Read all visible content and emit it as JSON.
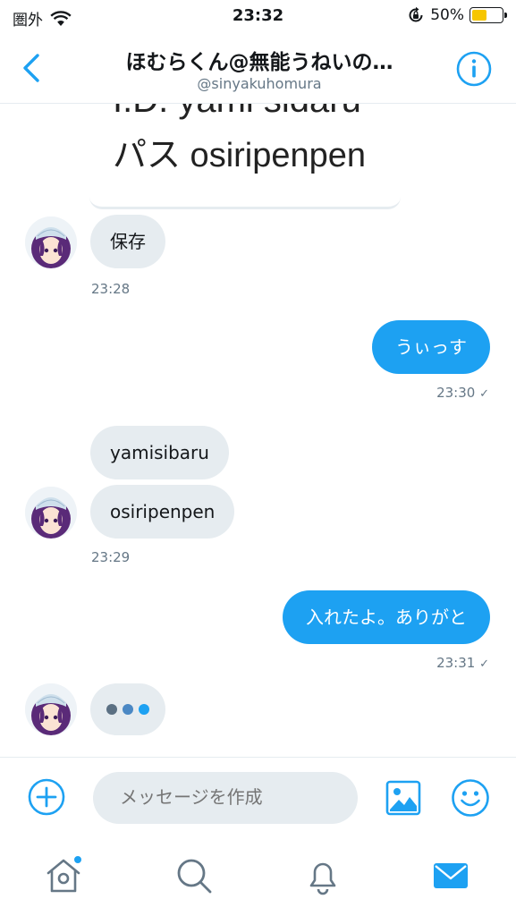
{
  "status_bar": {
    "carrier": "圏外",
    "time": "23:32",
    "battery_percent": "50%",
    "battery_level": 0.5,
    "icons": [
      "wifi-icon",
      "rotation-lock-icon",
      "battery-icon"
    ]
  },
  "header": {
    "title": "ほむらくん@無能うねいの…",
    "handle": "@sinyakuhomura",
    "icons": [
      "chevron-left-icon",
      "info-icon"
    ]
  },
  "colors": {
    "accent": "#1da1f2",
    "bubble_incoming": "#e6ecf0",
    "secondary_text": "#657786",
    "typing_dots": [
      "#5b7083",
      "#4b88c4",
      "#1da1f2"
    ]
  },
  "messages": {
    "image_text": [
      "I.D. yami sidaru",
      "パス  osiripenpen"
    ],
    "m1_text": "保存",
    "m1_time": "23:28",
    "m2_text": "うぃっす",
    "m2_time": "23:30",
    "m3_text": "yamisibaru",
    "m4_text": "osiripenpen",
    "m4_time": "23:29",
    "m5_text": "入れたよ。ありがと",
    "m5_time": "23:31",
    "read_mark": "✓"
  },
  "composer": {
    "placeholder": "メッセージを作成",
    "icons": [
      "plus-circle-icon",
      "image-icon",
      "emoji-icon"
    ]
  },
  "tabbar": {
    "icons": [
      "home-icon",
      "search-icon",
      "bell-icon",
      "mail-icon"
    ],
    "active": "mail-icon"
  }
}
